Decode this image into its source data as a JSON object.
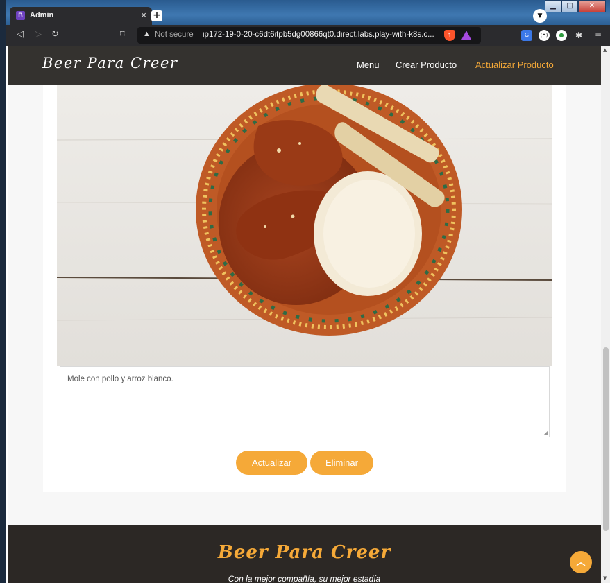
{
  "browser": {
    "tab_title": "Admin",
    "tab_favicon": "B",
    "tab_close": "×",
    "new_tab": "+",
    "security_label": "Not secure",
    "url": "ip172-19-0-20-c6dt6itpb5dg00866qt0.direct.labs.play-with-k8s.c...",
    "brave_shield_count": "1"
  },
  "navbar": {
    "brand": "Beer Para Creer",
    "links": [
      "Menu",
      "Crear Producto",
      "Actualizar Producto"
    ]
  },
  "form": {
    "description_value": "Mole con pollo y arroz blanco.",
    "update_label": "Actualizar",
    "delete_label": "Eliminar"
  },
  "footer": {
    "brand": "Beer Para Creer",
    "slogan": "Con la mejor compañía, su mejor estadía"
  },
  "colors": {
    "accent": "#f5a938",
    "navbar_bg": "#25221f",
    "footer_bg": "#2c2825"
  }
}
